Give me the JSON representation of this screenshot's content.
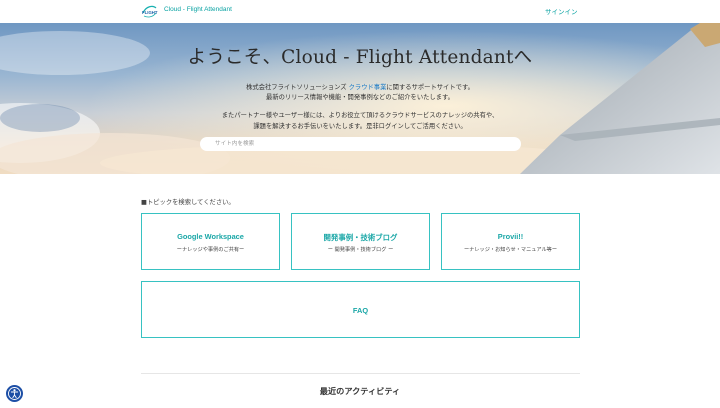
{
  "header": {
    "logo_text": "FLIGHT",
    "site_title": "Cloud - Flight Attendant",
    "signin_label": "サインイン"
  },
  "hero": {
    "title": "ようこそ、Cloud - Flight Attendantへ",
    "line1_pre": "株式会社フライトソリューションズ ",
    "line1_highlight": "クラウド事業",
    "line1_post": "に関するサポートサイトです。",
    "line2": "最新のリリース情報や機能・開発事例などのご紹介をいたします。",
    "line3": "またパートナー様やユーザー様には、よりお役立て頂けるクラウドサービスのナレッジの共有や、",
    "line4": "課題を解決するお手伝いをいたします。是非ログインしてご活用ください。",
    "search_placeholder": "サイト内を検索"
  },
  "topics": {
    "label": "■トピックを検索してください。",
    "cards": [
      {
        "title": "Google Workspace",
        "subtitle": "ーナレッジや事例のご共有ー"
      },
      {
        "title": "開発事例・技術ブログ",
        "subtitle": "ー 開発事例・技術ブログ ー"
      },
      {
        "title": "Provii!!",
        "subtitle": "ーナレッジ・お知らせ・マニュアル等ー"
      },
      {
        "title": "FAQ",
        "subtitle": ""
      }
    ]
  },
  "activity": {
    "title": "最近のアクティビティ"
  },
  "colors": {
    "accent": "#0aa3a3",
    "card_border": "#37c2c2",
    "link_blue": "#1a7ac6",
    "a11y_button": "#1d4fa6"
  },
  "icons": {
    "logo": "flight-logo-icon",
    "accessibility": "accessibility-icon"
  }
}
